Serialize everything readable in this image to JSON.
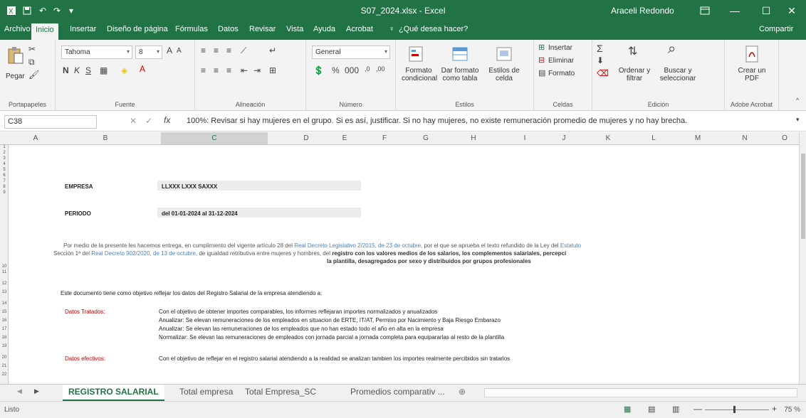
{
  "titlebar": {
    "doc_title": "S07_2024.xlsx - Excel",
    "user": "Araceli Redondo",
    "colors": {
      "brand": "#217346"
    }
  },
  "tabs": [
    "Archivo",
    "Inicio",
    "Insertar",
    "Diseño de página",
    "Fórmulas",
    "Datos",
    "Revisar",
    "Vista",
    "Ayuda",
    "Acrobat"
  ],
  "tell_me": "¿Qué desea hacer?",
  "share": "Compartir",
  "ribbon": {
    "clipboard": {
      "paste": "Pegar",
      "label": "Portapapeles"
    },
    "font": {
      "name": "Tahoma",
      "size": "8",
      "label": "Fuente"
    },
    "alignment": {
      "label": "Alineación"
    },
    "number": {
      "format": "General",
      "label": "Número"
    },
    "styles": {
      "conditional": "Formato condicional",
      "as_table": "Dar formato como tabla",
      "cell_styles": "Estilos de celda",
      "label": "Estilos"
    },
    "cells": {
      "insert": "Insertar",
      "delete": "Eliminar",
      "format": "Formato",
      "label": "Celdas"
    },
    "editing": {
      "sort": "Ordenar y filtrar",
      "find": "Buscar y seleccionar",
      "label": "Edición"
    },
    "acrobat": {
      "create_pdf": "Crear un PDF",
      "label": "Adobe Acrobat"
    }
  },
  "formula_bar": {
    "name_box": "C38",
    "formula": "100%: Revisar si hay mujeres en el grupo. Si es así, justificar. Si no hay mujeres, no existe remuneración promedio de mujeres y no hay brecha."
  },
  "columns": [
    "A",
    "B",
    "C",
    "D",
    "E",
    "F",
    "G",
    "H",
    "I",
    "J",
    "K",
    "L",
    "M",
    "N",
    "O"
  ],
  "rows": [
    "1",
    "2",
    "3",
    "4",
    "5",
    "6",
    "7",
    "8",
    "9",
    "10",
    "11",
    "12",
    "13",
    "14",
    "15",
    "16",
    "17",
    "18",
    "19",
    "20",
    "21",
    "22"
  ],
  "sheet": {
    "empresa_label": "EMPRESA",
    "empresa_value": "LLXXX LXXX SAXXX",
    "periodo_label": "PERIODO",
    "periodo_value": "del 01-01-2024 al 31-12-2024",
    "intro_line1_a": "Por medio de la presente les hacemos entrega, en cumplimiento del vigente artículo 28 del ",
    "intro_line1_link": "Real Decreto Legislativo 2/2015, de 23 de octubre,",
    "intro_line1_b": " por el que se aprueba el texto refundido de la Ley del ",
    "intro_line1_link2": "Estatuto",
    "intro_line2_a": "Sección 1ª del ",
    "intro_line2_link": "Real Decreto 902/2020, de 13 de octubre,",
    "intro_line2_b": " de igualdad retributiva entre mujeres y hombres, del ",
    "intro_line2_bold": "registro con los valores medios de los salarios, los complementos salariales, percepci",
    "intro_line3": "la plantilla, desagregados por sexo y distribuidos por grupos profesionales",
    "objective": "Este documento tiene como objetivo reflejar los datos del Registro Salarial de la empresa atendiendo a:",
    "datos_tratados_label": "Datos Tratados:",
    "datos_tratados": [
      "Con el objetivo de obtener importes comparables, los informes reflejaran importes normalizados y anualizados",
      "Anualizar: Se elevan remuneraciones de los empleados en situacion de ERTE, IT/AT, Permiso por Nacimiento y Baja Riesgo Embarazo",
      "Anualizar: Se elevan las remuneraciones de los empleados que no han estado todo el año en alta en la empresa",
      "Normalizar: Se elevan las remuneraciones de empleados con jornada parcial a jornada completa para equipararlas al resto de la plantilla"
    ],
    "datos_efectivos_label": "Datos efectivos:",
    "datos_efectivos": "Con el objetivo de reflejar en el registro salarial atendiendo a la realidad se analizan tambien los importes realmente percibidos sin tratarlos"
  },
  "sheet_tabs": [
    "REGISTRO SALARIAL",
    "Total empresa",
    "Total Empresa_SC",
    "Promedios comparativ ..."
  ],
  "status": {
    "ready": "Listo",
    "zoom": "75 %"
  }
}
